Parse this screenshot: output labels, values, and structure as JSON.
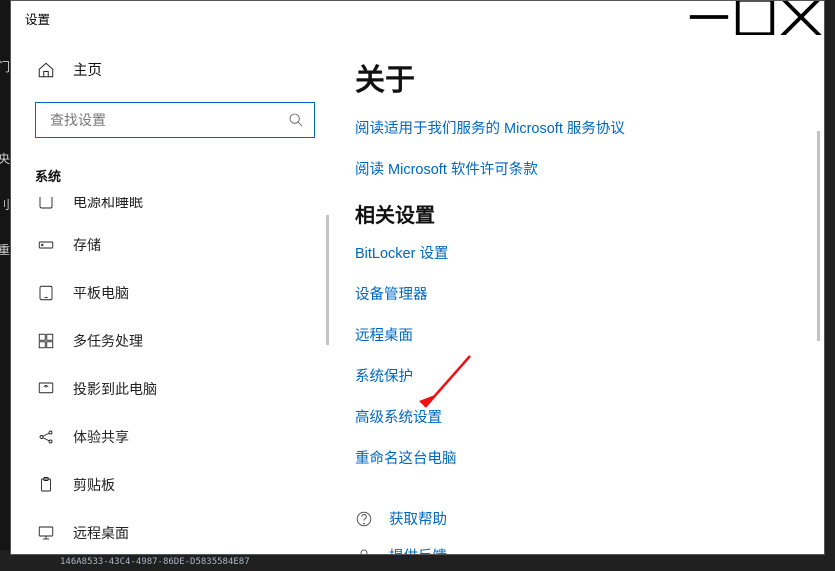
{
  "window_title": "设置",
  "sidebar": {
    "home": "主页",
    "search_placeholder": "查找设置",
    "category": "系统",
    "items": [
      {
        "label": "电源和睡眠"
      },
      {
        "label": "存储"
      },
      {
        "label": "平板电脑"
      },
      {
        "label": "多任务处理"
      },
      {
        "label": "投影到此电脑"
      },
      {
        "label": "体验共享"
      },
      {
        "label": "剪贴板"
      },
      {
        "label": "远程桌面"
      }
    ]
  },
  "main": {
    "title": "关于",
    "top_links": [
      "阅读适用于我们服务的 Microsoft 服务协议",
      "阅读 Microsoft 软件许可条款"
    ],
    "related_heading": "相关设置",
    "related_links": [
      "BitLocker 设置",
      "设备管理器",
      "远程桌面",
      "系统保护",
      "高级系统设置",
      "重命名这台电脑"
    ],
    "help": "获取帮助",
    "feedback": "提供反馈"
  },
  "bg_text": "146A8533-43C4-4987-86DE-D5835584E87"
}
